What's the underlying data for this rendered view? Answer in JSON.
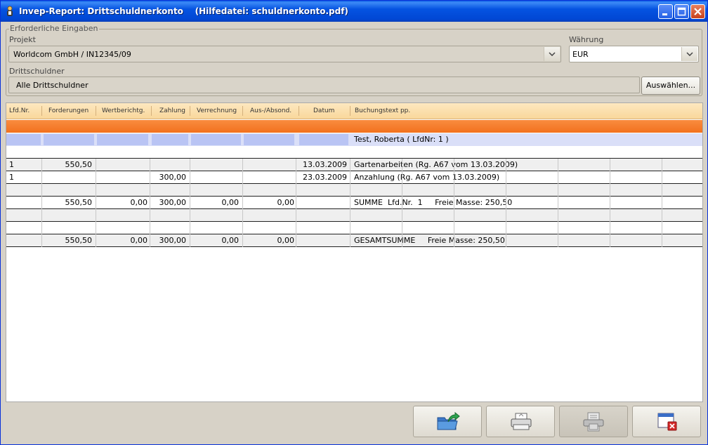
{
  "window": {
    "title": "Invep-Report: Drittschuldnerkonto    (Hilfedatei: schuldnerkonto.pdf)"
  },
  "form": {
    "group_title": "Erforderliche Eingaben",
    "project_label": "Projekt",
    "project_value": "Worldcom GmbH / IN12345/09",
    "currency_label": "Währung",
    "currency_value": "EUR",
    "debtor_label": "Drittschuldner",
    "debtor_value": "Alle Drittschuldner",
    "select_button": "Auswählen..."
  },
  "table": {
    "headers": [
      "Lfd.Nr.",
      "Forderungen",
      "Wertberichtg.",
      "Zahlung",
      "Verrechnung",
      "Aus-/Absond.",
      "Datum",
      "Buchungstext pp."
    ],
    "group_row": "Test, Roberta ( LfdNr: 1 )",
    "rows": [
      {
        "nr": "1",
        "forderungen": "550,50",
        "wert": "",
        "zahlung": "",
        "verrechnung": "",
        "aus": "",
        "datum": "13.03.2009",
        "text": "Gartenarbeiten (Rg. A67 vom 13.03.2009)"
      },
      {
        "nr": "1",
        "forderungen": "",
        "wert": "",
        "zahlung": "300,00",
        "verrechnung": "",
        "aus": "",
        "datum": "23.03.2009",
        "text": "Anzahlung (Rg. A67 vom 13.03.2009)"
      }
    ],
    "summe": {
      "forderungen": "550,50",
      "wert": "0,00",
      "zahlung": "300,00",
      "verrechnung": "0,00",
      "aus": "0,00",
      "text": "SUMME  Lfd.Nr.  1     Freie Masse: 250,50"
    },
    "gesamt": {
      "forderungen": "550,50",
      "wert": "0,00",
      "zahlung": "300,00",
      "verrechnung": "0,00",
      "aus": "0,00",
      "text": "GESAMTSUMME     Freie Masse: 250,50"
    }
  },
  "toolbar": {
    "icons": [
      "export-icon",
      "print-icon",
      "print-preview-icon",
      "close-window-icon"
    ]
  },
  "colors": {
    "title_bar": "#0553e1",
    "header_bg": "#f9d79b",
    "orange_bar": "#f2711e",
    "group_row": "#dadff8"
  }
}
